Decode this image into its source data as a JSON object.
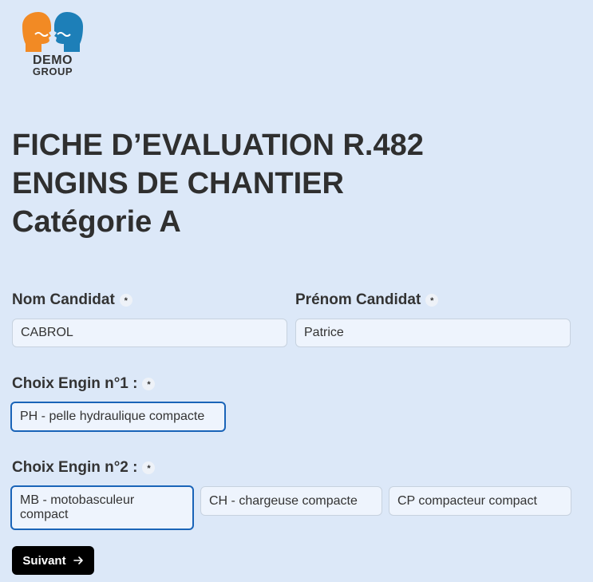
{
  "logo": {
    "line1": "DEMO",
    "line2": "GROUP"
  },
  "title": {
    "line1": "FICHE D’EVALUATION R.482",
    "line2": "ENGINS DE CHANTIER",
    "line3": "Catégorie A"
  },
  "form": {
    "required_mark": "*",
    "nom": {
      "label": "Nom Candidat",
      "value": "CABROL"
    },
    "prenom": {
      "label": "Prénom Candidat",
      "value": "Patrice"
    },
    "engin1": {
      "label": "Choix Engin n°1 :",
      "options": [
        {
          "label": "PH - pelle hydraulique compacte",
          "selected": true
        }
      ]
    },
    "engin2": {
      "label": "Choix Engin n°2 :",
      "options": [
        {
          "label": "MB - motobasculeur compact",
          "selected": true
        },
        {
          "label": "CH - chargeuse compacte",
          "selected": false
        },
        {
          "label": "CP compacteur compact",
          "selected": false
        }
      ]
    }
  },
  "buttons": {
    "next": "Suivant",
    "next_icon": "arrow-right-icon"
  },
  "colors": {
    "background": "#dce8f8",
    "selected_border": "#1a64b8",
    "button_bg": "#000000",
    "logo_orange": "#f28a24",
    "logo_blue": "#1d7fb8"
  }
}
